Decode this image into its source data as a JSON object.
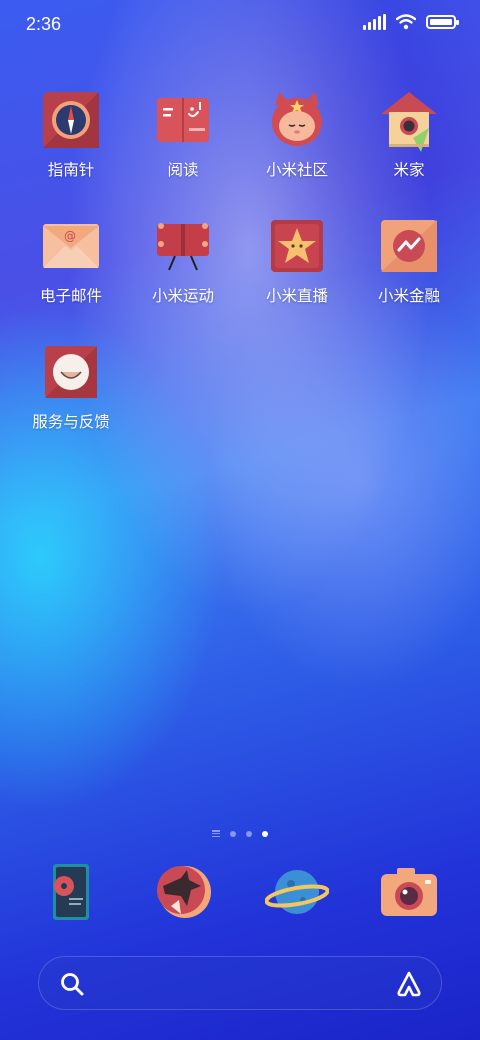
{
  "status_bar": {
    "time": "2:36"
  },
  "home_apps": [
    {
      "label": "指南针"
    },
    {
      "label": "阅读"
    },
    {
      "label": "小米社区"
    },
    {
      "label": "米家"
    },
    {
      "label": "电子邮件"
    },
    {
      "label": "小米运动"
    },
    {
      "label": "小米直播"
    },
    {
      "label": "小米金融"
    },
    {
      "label": "服务与反馈"
    }
  ],
  "dock": [
    {
      "icon": "music-player-icon"
    },
    {
      "icon": "browser-icon"
    },
    {
      "icon": "planet-icon"
    },
    {
      "icon": "camera-icon"
    }
  ],
  "page_indicator": {
    "pages": 3,
    "active": 3
  },
  "colors": {
    "accent": "#3f5ce8",
    "icon_red": "#c94a55",
    "icon_peach": "#f3a77c"
  }
}
